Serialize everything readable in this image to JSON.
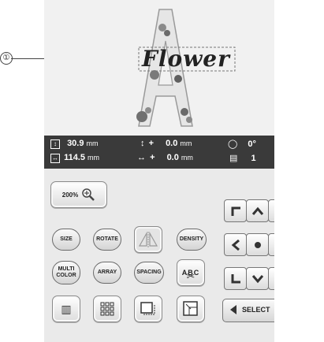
{
  "callout": {
    "number": "①"
  },
  "preview": {
    "text": "Flower",
    "letter": "A"
  },
  "info": {
    "height_value": "30.9",
    "height_unit": "mm",
    "width_value": "114.5",
    "width_unit": "mm",
    "vert_offset_sign": "+",
    "vert_offset_value": "0.0",
    "vert_offset_unit": "mm",
    "horiz_offset_sign": "+",
    "horiz_offset_value": "0.0",
    "horiz_offset_unit": "mm",
    "rotation_value": "0°",
    "thread_count": "1"
  },
  "buttons": {
    "zoom": "200%",
    "size": "SIZE",
    "rotate": "ROTATE",
    "density": "DENSITY",
    "multicolor_line1": "MULTI",
    "multicolor_line2": "COLOR",
    "array": "ARRAY",
    "spacing": "SPACING",
    "abc": "ABC",
    "select": "SELECT"
  }
}
